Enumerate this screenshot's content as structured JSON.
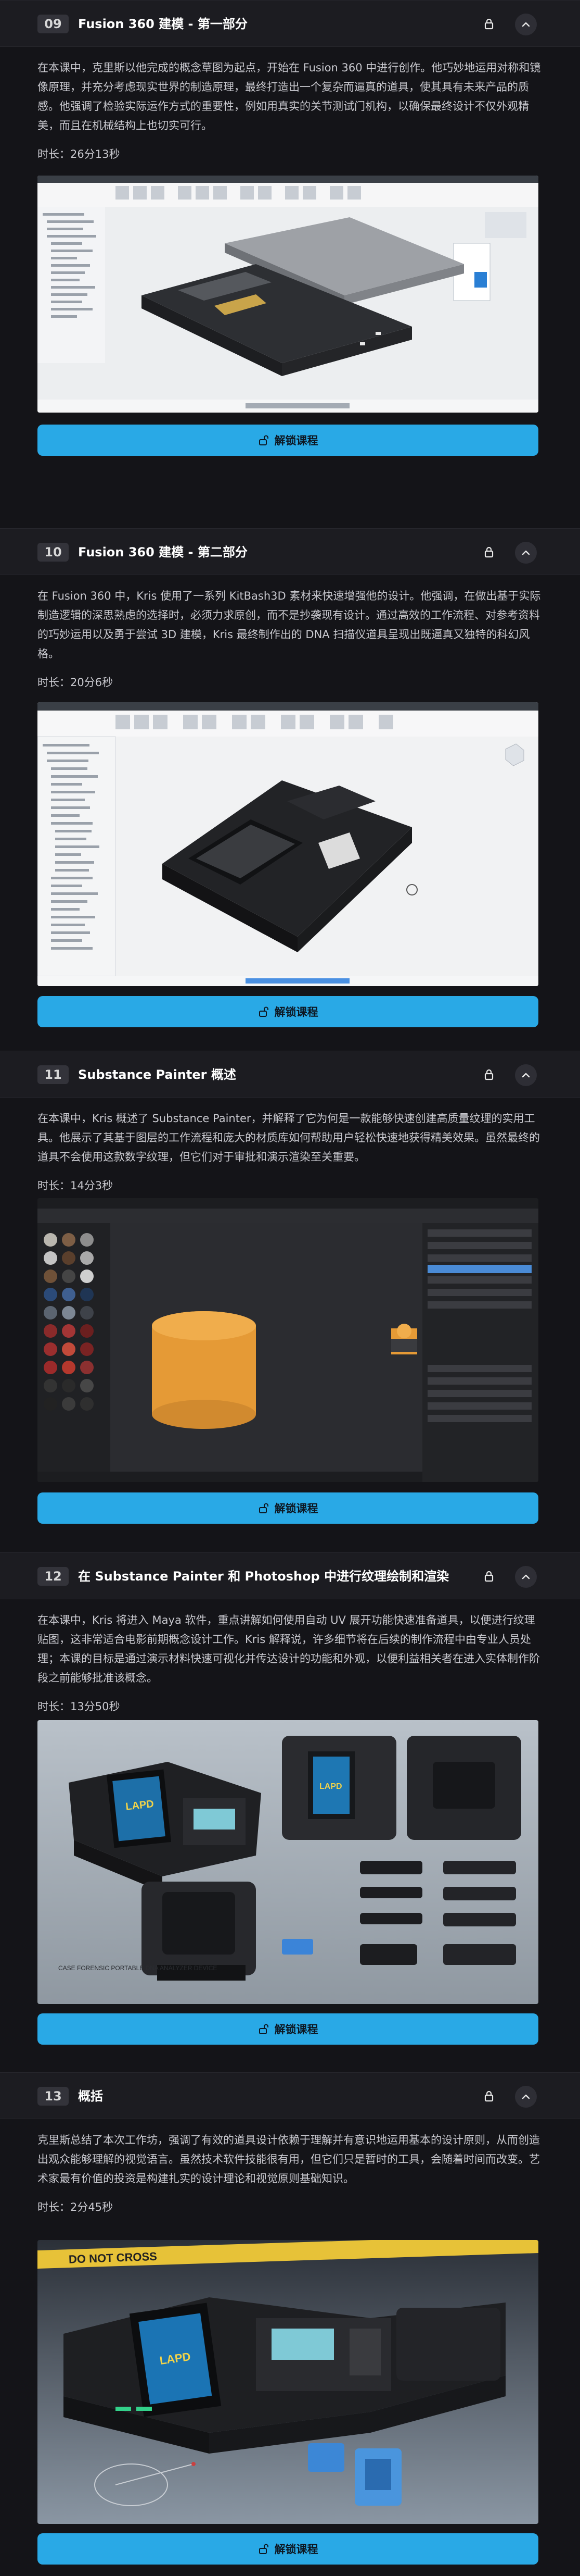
{
  "lessons": [
    {
      "num": "09",
      "title": "Fusion 360 建模 - 第一部分",
      "description": "在本课中，克里斯以他完成的概念草图为起点，开始在 Fusion 360 中进行创作。他巧妙地运用对称和镜像原理，并充分考虑现实世界的制造原理，最终打造出一个复杂而逼真的道具，使其具有未来产品的质感。他强调了检验实际运作方式的重要性，例如用真实的关节测试门机构，以确保最终设计不仅外观精美，而且在机械结构上也切实可行。",
      "duration": "时长：26分13秒",
      "thumb_icon": "fusion360-screenshot",
      "button_label": "解锁课程"
    },
    {
      "num": "10",
      "title": "Fusion 360 建模 - 第二部分",
      "description": "在 Fusion 360 中，Kris 使用了一系列 KitBash3D 素材来快速增强他的设计。他强调，在做出基于实际制造逻辑的深思熟虑的选择时，必须力求原创，而不是抄袭现有设计。通过高效的工作流程、对参考资料的巧妙运用以及勇于尝试 3D 建模，Kris 最终制作出的 DNA 扫描仪道具呈现出既逼真又独特的科幻风格。",
      "duration": "时长：20分6秒",
      "thumb_icon": "fusion360-screenshot",
      "button_label": "解锁课程"
    },
    {
      "num": "11",
      "title": "Substance Painter 概述",
      "description": "在本课中，Kris 概述了 Substance Painter，并解释了它为何是一款能够快速创建高质量纹理的实用工具。他展示了其基于图层的工作流程和庞大的材质库如何帮助用户轻松快速地获得精美效果。虽然最终的道具不会使用这款数字纹理，但它们对于审批和演示渲染至关重要。",
      "duration": "时长：14分3秒",
      "thumb_icon": "substance-painter-screenshot",
      "button_label": "解锁课程"
    },
    {
      "num": "12",
      "title": "在 Substance Painter 和 Photoshop 中进行纹理绘制和渲染",
      "description": "在本课中，Kris 将进入 Maya 软件，重点讲解如何使用自动 UV 展开功能快速准备道具，以便进行纹理贴图，这非常适合电影前期概念设计工作。Kris 解释说，许多细节将在后续的制作流程中由专业人员处理；本课的目标是通过演示材料快速可视化并传达设计的功能和外观，以便利益相关者在进入实体制作阶段之前能够批准该概念。",
      "duration": "时长：13分50秒",
      "thumb_icon": "render-sheet",
      "render_caption": "CASE FORENSIC\nPORTABLE DNA ANALYZER\nDEVICE",
      "render_brand": "LAPD",
      "button_label": "解锁课程"
    },
    {
      "num": "13",
      "title": "概括",
      "description": "克里斯总结了本次工作坊，强调了有效的道具设计依赖于理解并有意识地运用基本的设计原则，从而创造出观众能够理解的视觉语言。虽然技术软件技能很有用，但它们只是暂时的工具，会随着时间而改变。艺术家最有价值的投资是构建扎实的设计理论和视觉原则基础知识。",
      "duration": "时长：2分45秒",
      "thumb_icon": "final-render",
      "render_brand": "LAPD",
      "tape_text": "DO NOT CROSS",
      "button_label": "解锁课程"
    }
  ],
  "colors": {
    "accent": "#29a9e6",
    "bg": "#141418",
    "header_bg": "#1c1c21"
  }
}
